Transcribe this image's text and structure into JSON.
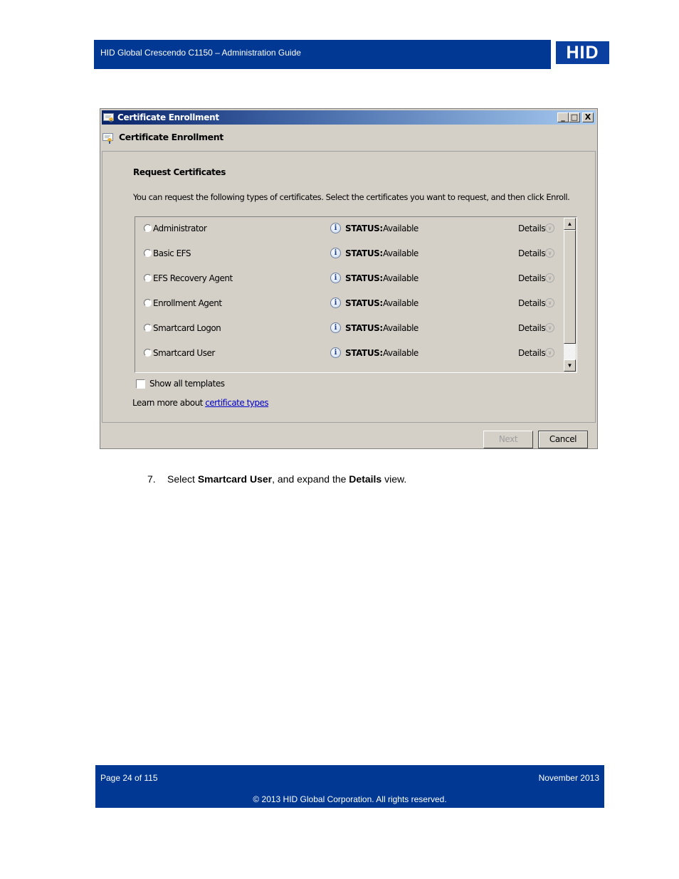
{
  "header": {
    "title": "HID Global Crescendo C1150  – Administration Guide",
    "logo_text": "HID"
  },
  "dialog": {
    "window_title": "Certificate Enrollment",
    "window_buttons": {
      "minimize": "_",
      "maximize": "□",
      "close": "X"
    },
    "subheading": "Certificate Enrollment",
    "section_title": "Request Certificates",
    "description": "You can request the following types of certificates. Select the certificates you want to request, and then click Enroll.",
    "certificates": [
      {
        "name": "Administrator",
        "status_label": "STATUS:",
        "status": "Available",
        "details_label": "Details",
        "selected": false
      },
      {
        "name": "Basic EFS",
        "status_label": "STATUS:",
        "status": "Available",
        "details_label": "Details",
        "selected": false
      },
      {
        "name": "EFS Recovery Agent",
        "status_label": "STATUS:",
        "status": "Available",
        "details_label": "Details",
        "selected": false
      },
      {
        "name": "Enrollment Agent",
        "status_label": "STATUS:",
        "status": "Available",
        "details_label": "Details",
        "selected": false
      },
      {
        "name": "Smartcard Logon",
        "status_label": "STATUS:",
        "status": "Available",
        "details_label": "Details",
        "selected": false
      },
      {
        "name": "Smartcard User",
        "status_label": "STATUS:",
        "status": "Available",
        "details_label": "Details",
        "selected": false
      }
    ],
    "show_all_templates": {
      "label": "Show all templates",
      "checked": false
    },
    "learn_more_prefix": "Learn more about ",
    "learn_more_link": "certificate types",
    "buttons": {
      "next": "Next",
      "cancel": "Cancel"
    }
  },
  "instruction": {
    "number": "7.",
    "text_1": "Select ",
    "bold_1": "Smartcard User",
    "text_2": ", and expand the ",
    "bold_2": "Details",
    "text_3": " view."
  },
  "footer": {
    "page": "Page 24 of 115",
    "date": "November 2013",
    "copyright": "© 2013 HID Global Corporation. All rights reserved."
  },
  "colors": {
    "brand_blue": "#003893",
    "dialog_gray": "#d4d0c8",
    "link_blue": "#0000cc"
  }
}
